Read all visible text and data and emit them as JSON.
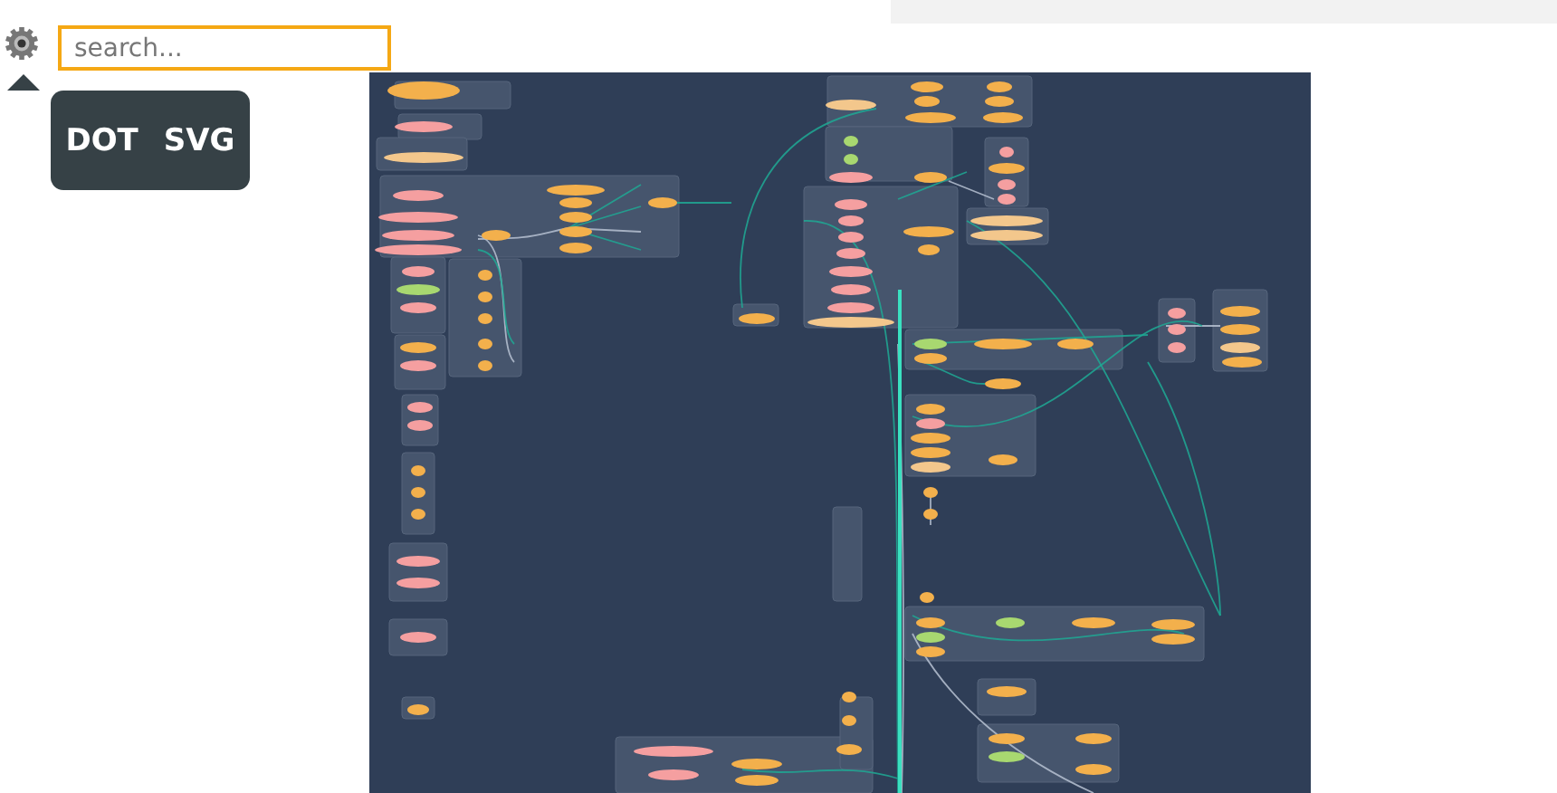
{
  "search": {
    "placeholder": "search..."
  },
  "export_menu": {
    "buttons": [
      "DOT",
      "SVG"
    ]
  }
}
